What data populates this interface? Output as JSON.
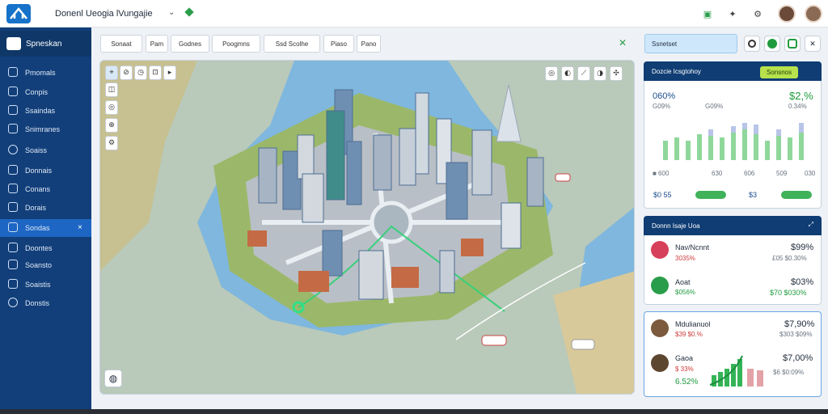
{
  "header": {
    "app_title": "Donenl Ueogia lVungajie",
    "icons": [
      "home-logo-icon",
      "chevron-down-icon",
      "diamond-icon",
      "doc-icon",
      "puzzle-icon",
      "gear-icon"
    ]
  },
  "sidebar": {
    "brand": "Spneskan",
    "items": [
      {
        "label": "Pmomals",
        "icon": "bell-icon"
      },
      {
        "label": "Conpis",
        "icon": "monitor-icon"
      },
      {
        "label": "Ssaindas",
        "icon": "list-icon"
      },
      {
        "label": "Snimranes",
        "icon": "table-icon"
      },
      {
        "label": "Soaiss",
        "icon": "globe-icon"
      },
      {
        "label": "Donnais",
        "icon": "car-icon"
      },
      {
        "label": "Conans",
        "icon": "calendar-icon"
      },
      {
        "label": "Dorais",
        "icon": "layers-icon"
      },
      {
        "label": "Sondas",
        "icon": "home-icon",
        "active": true,
        "close": "×"
      },
      {
        "label": "Doontes",
        "icon": "map-icon"
      },
      {
        "label": "Soansto",
        "icon": "box-icon"
      },
      {
        "label": "Soaistis",
        "icon": "graph-icon"
      },
      {
        "label": "Donstis",
        "icon": "pin-icon"
      }
    ]
  },
  "toolbar": {
    "buttons": [
      "Sonaat",
      "Pam",
      "Godnes",
      "Poogmns",
      "Ssd Scolhe",
      "Piaso",
      "Pano"
    ],
    "close": "✕"
  },
  "map": {
    "top_tools": [
      "Pin",
      "Ha",
      "Dio",
      "Pie",
      "Oxt"
    ],
    "right_tools": [
      "◎",
      "◐",
      "⟋",
      "◑",
      "✣"
    ]
  },
  "right_panel": {
    "search_label": "Ssnetset",
    "stats": {
      "title": "Dozcie Icsgtohoy",
      "badge": "Sonsnos",
      "values": [
        "060%",
        "$2,%",
        "G09%",
        "G09%",
        "0.34%"
      ],
      "axis": [
        "■ 600",
        "630",
        "606",
        "509",
        "030"
      ],
      "footer_left": "$0 55",
      "footer_right": "$3"
    },
    "list_head": "Donnn Isaje Uoa",
    "entries": [
      {
        "name": "Nav/Ncnnt",
        "sub": "3035%",
        "value": "$99%",
        "sub_value": "£05 $0.30%",
        "color": "#d6405a"
      },
      {
        "name": "Aoat",
        "sub": "$056%",
        "value": "$03%",
        "sub_value": "$70 $030%",
        "color": "#2a9d4a"
      },
      {
        "name": "Mdulianuol",
        "sub": "$39 $0.%",
        "value": "$7,90%",
        "sub_value": "$303 $09%",
        "color": "#7b5a3d"
      },
      {
        "name": "Gaoa",
        "sub": "$ 33%",
        "value": "$7,00%",
        "sub_value": "$6 $0:09%",
        "color": "#5d4630"
      }
    ],
    "last_sub": "6.52%"
  }
}
